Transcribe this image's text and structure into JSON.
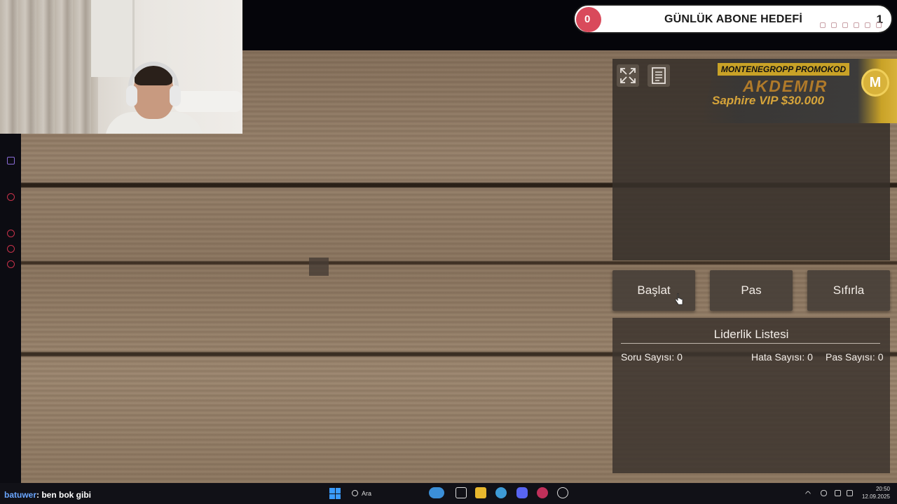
{
  "goal": {
    "count": "0",
    "title": "GÜNLÜK ABONE HEDEFİ",
    "target": "1"
  },
  "promo": {
    "label": "MONTENEGROPP PROMOKOD",
    "name": "AKDEMIR",
    "vip": "Saphire VIP $30.000",
    "logo_letter": "M"
  },
  "controls": {
    "start": "Başlat",
    "pass": "Pas",
    "reset": "Sıfırla"
  },
  "leaderboard": {
    "title": "Liderlik Listesi",
    "questions": "Soru Sayısı: 0",
    "errors": "Hata Sayısı: 0",
    "passes": "Pas Sayısı: 0"
  },
  "chat": {
    "user": "batuwer",
    "message": ": ben bok gibi"
  },
  "taskbar": {
    "search": "Ara",
    "time": "20:50",
    "date": "12.09.2025"
  },
  "colors": {
    "goal_accent": "#d94a5b",
    "promo_gold": "#c9a227"
  }
}
